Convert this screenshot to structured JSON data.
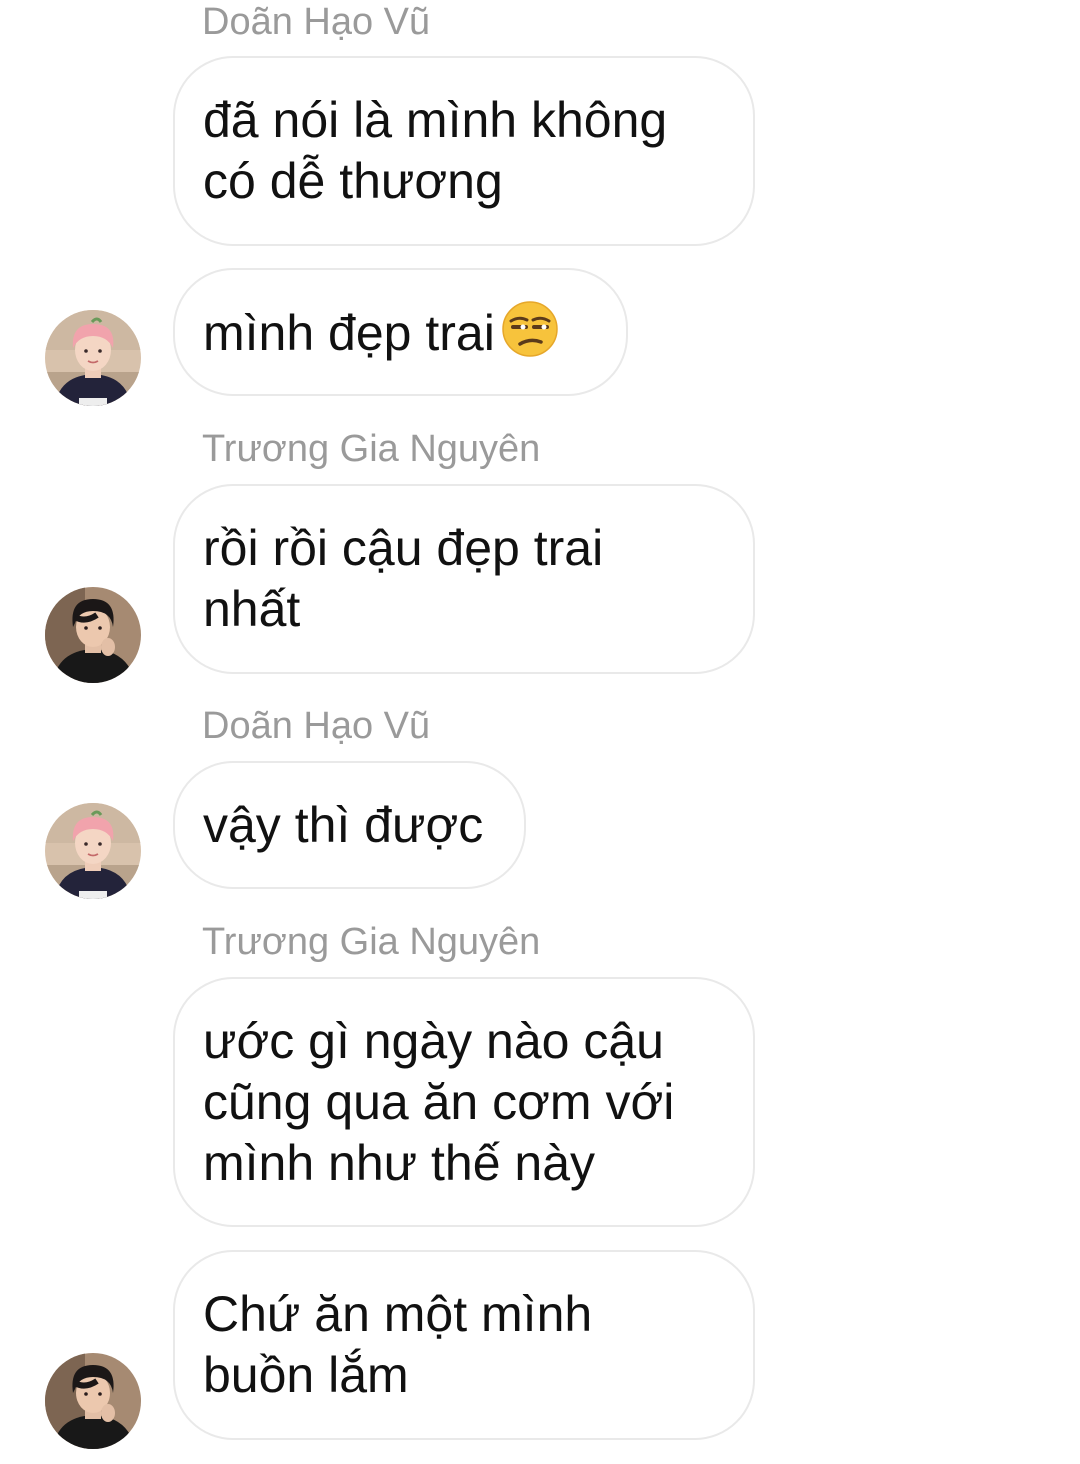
{
  "messages": [
    {
      "sender": "Doãn Hạo Vũ",
      "text": "đã nói là mình không\ncó dễ thương"
    },
    {
      "text": "mình đẹp trai",
      "emoji": "unamused-face-emoji"
    },
    {
      "sender": "Trương Gia Nguyên",
      "text": "rồi rồi cậu đẹp trai\nnhất"
    },
    {
      "sender": "Doãn Hạo Vũ",
      "text": "vậy thì được"
    },
    {
      "sender": "Trương Gia Nguyên",
      "text": "ước gì ngày nào cậu\ncũng qua ăn cơm với\nmình như thế này"
    },
    {
      "text": "Chứ ăn một mình\nbuồn lắm"
    }
  ],
  "avatars": {
    "doan_hao_vu": {
      "icon": "pink-hair-person-avatar"
    },
    "truong_gia_nguyen": {
      "icon": "dark-hair-person-avatar"
    }
  },
  "colors": {
    "background": "#ffffff",
    "bubble_border": "#e9e9e9",
    "sender_name": "#9a9a9a",
    "message_text": "#111111"
  }
}
